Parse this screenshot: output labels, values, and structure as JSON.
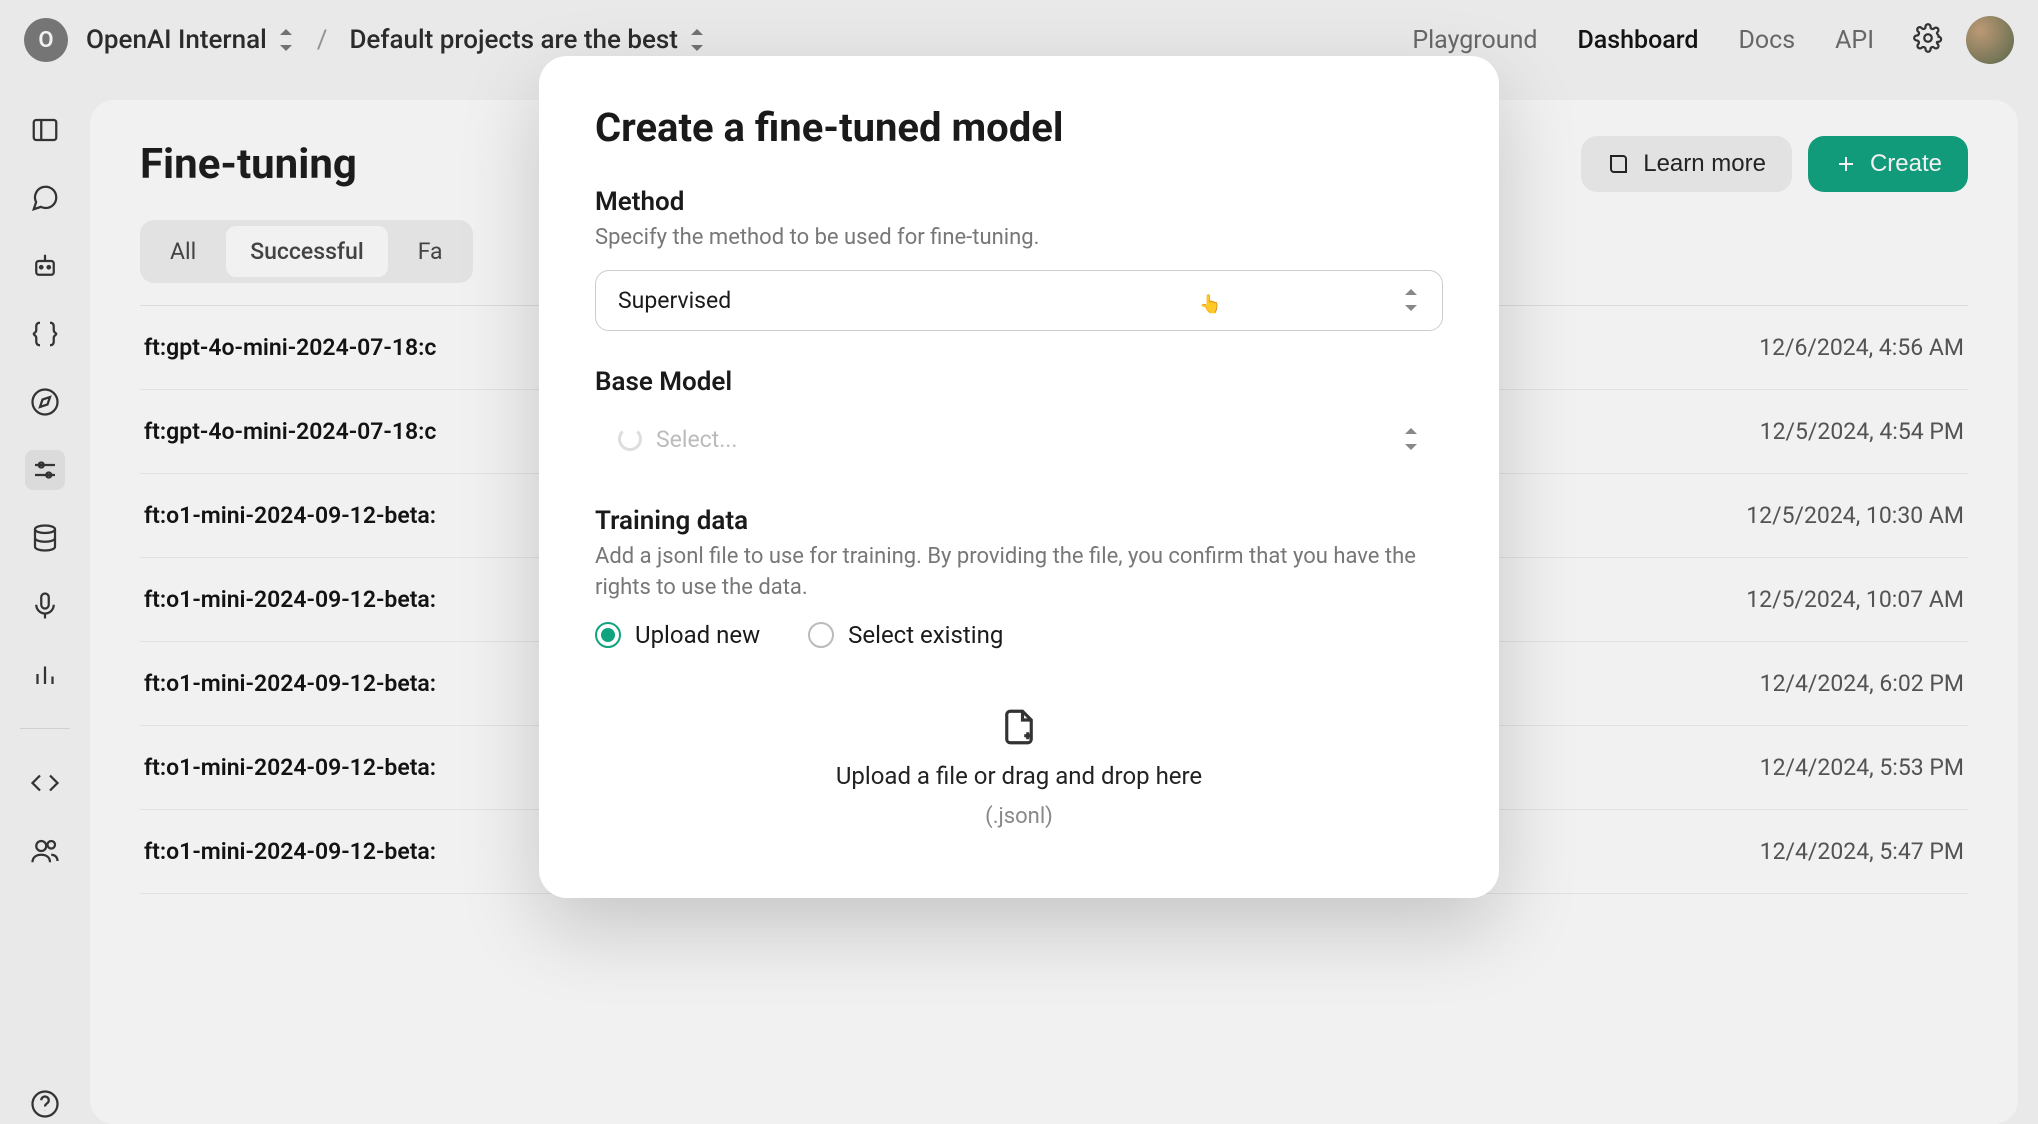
{
  "topbar": {
    "org_initial": "O",
    "org_name": "OpenAI Internal",
    "separator": "/",
    "project_name": "Default projects are the best",
    "nav": {
      "playground": "Playground",
      "dashboard": "Dashboard",
      "docs": "Docs",
      "api": "API"
    }
  },
  "page": {
    "title": "Fine-tuning",
    "learn_more": "Learn more",
    "create": "Create",
    "tabs": {
      "all": "All",
      "successful": "Successful",
      "failed_prefix": "Fa"
    },
    "rows": [
      {
        "name": "ft:gpt-4o-mini-2024-07-18:c",
        "ts": "12/6/2024, 4:56 AM"
      },
      {
        "name": "ft:gpt-4o-mini-2024-07-18:c",
        "ts": "12/5/2024, 4:54 PM"
      },
      {
        "name": "ft:o1-mini-2024-09-12-beta:",
        "ts": "12/5/2024, 10:30 AM"
      },
      {
        "name": "ft:o1-mini-2024-09-12-beta:",
        "ts": "12/5/2024, 10:07 AM"
      },
      {
        "name": "ft:o1-mini-2024-09-12-beta:",
        "ts": "12/4/2024, 6:02 PM"
      },
      {
        "name": "ft:o1-mini-2024-09-12-beta:",
        "ts": "12/4/2024, 5:53 PM"
      },
      {
        "name": "ft:o1-mini-2024-09-12-beta:",
        "ts": "12/4/2024, 5:47 PM"
      }
    ]
  },
  "modal": {
    "title": "Create a fine-tuned model",
    "method": {
      "label": "Method",
      "desc": "Specify the method to be used for fine-tuning.",
      "value": "Supervised"
    },
    "base_model": {
      "label": "Base Model",
      "placeholder": "Select..."
    },
    "training": {
      "label": "Training data",
      "desc": "Add a jsonl file to use for training. By providing the file, you confirm that you have the rights to use the data.",
      "upload_new": "Upload new",
      "select_existing": "Select existing",
      "dropzone_text": "Upload a file or drag and drop here",
      "dropzone_hint": "(.jsonl)"
    }
  }
}
